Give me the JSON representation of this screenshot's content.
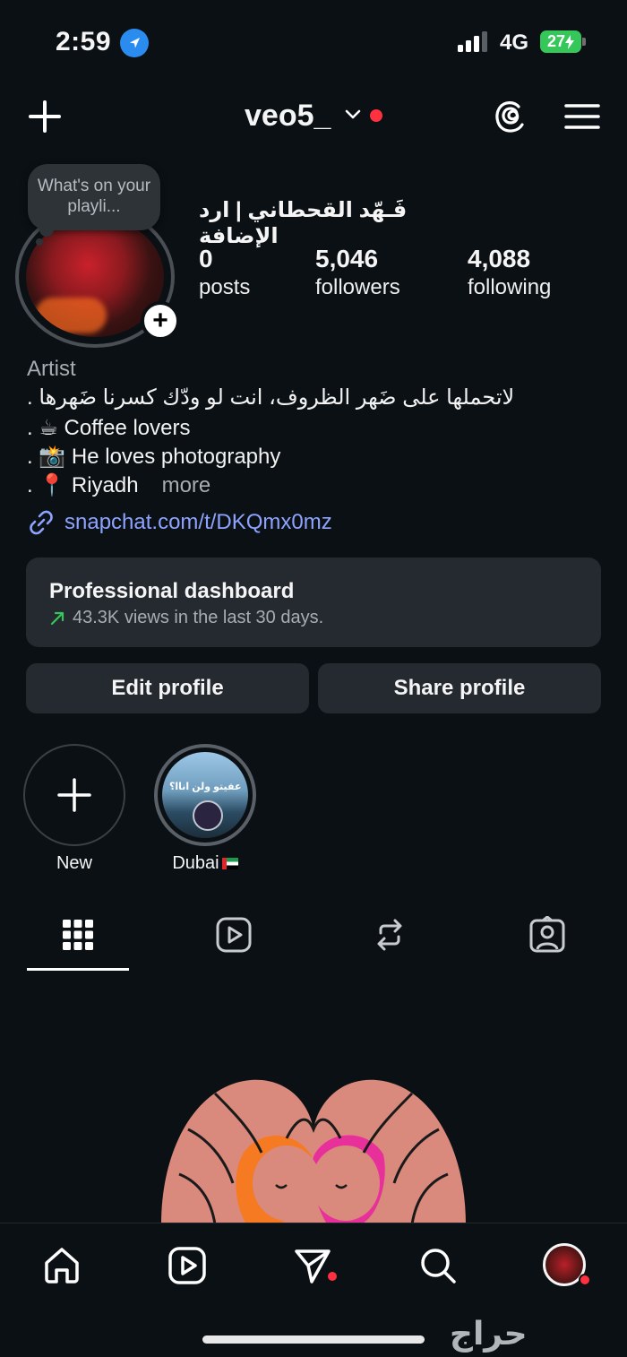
{
  "status_bar": {
    "time": "2:59",
    "network": "4G",
    "battery": "27"
  },
  "header": {
    "username": "veo5_"
  },
  "profile": {
    "note": "What's on your playli...",
    "display_name": "فَـهّد القحطاني | ارد الإضافة",
    "stats": [
      {
        "value": "0",
        "label": "posts"
      },
      {
        "value": "5,046",
        "label": "followers"
      },
      {
        "value": "4,088",
        "label": "following"
      }
    ],
    "category": "Artist",
    "bio": [
      "لاتحملها على ضَهر الظروف، انت لو ودّك كسرنا ضَهرها .",
      ". ☕ Coffee lovers",
      ". 📸 He loves photography",
      ". 📍 Riyadh"
    ],
    "more": "more",
    "link": "snapchat.com/t/DKQmx0mz"
  },
  "dashboard": {
    "title": "Professional dashboard",
    "subtitle": "43.3K views in the last 30 days."
  },
  "buttons": {
    "edit": "Edit profile",
    "share": "Share profile"
  },
  "highlights": [
    {
      "label": "New",
      "icon": "plus-icon"
    },
    {
      "label": "Dubai",
      "image_text": "عفيتو ولن اناا؟"
    }
  ],
  "tabs": [
    "grid-icon",
    "reels-icon",
    "reposts-icon",
    "tagged-icon"
  ],
  "bottom_nav": [
    "home-icon",
    "reels-icon",
    "messages-icon",
    "search-icon",
    "profile-avatar"
  ],
  "watermark": "حراج",
  "colors": {
    "background": "#0b1014",
    "surface": "#252a30",
    "link": "#8da3ff",
    "notification": "#ff3040",
    "trend": "#35c759"
  }
}
